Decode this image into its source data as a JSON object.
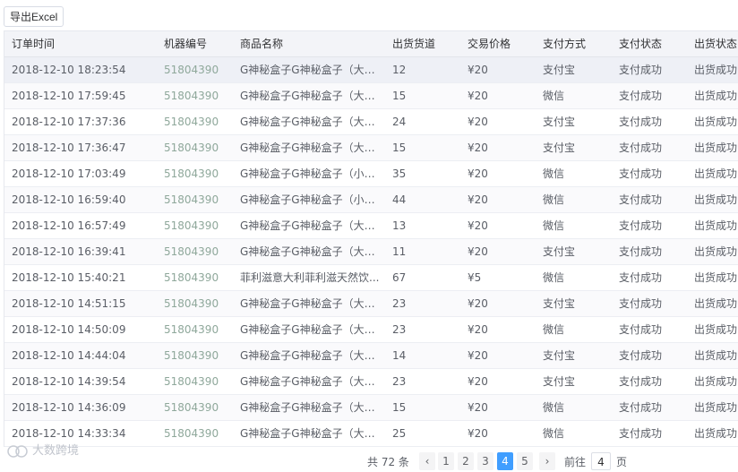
{
  "toolbar": {
    "export_label": "导出Excel"
  },
  "table": {
    "headers": [
      "订单时间",
      "机器编号",
      "商品名称",
      "出货货道",
      "交易价格",
      "支付方式",
      "支付状态",
      "出货状态"
    ],
    "rows": [
      [
        "2018-12-10 18:23:54",
        "51804390",
        "G神秘盒子G神秘盒子（大）...",
        "12",
        "¥20",
        "支付宝",
        "支付成功",
        "出货成功"
      ],
      [
        "2018-12-10 17:59:45",
        "51804390",
        "G神秘盒子G神秘盒子（大）...",
        "15",
        "¥20",
        "微信",
        "支付成功",
        "出货成功"
      ],
      [
        "2018-12-10 17:37:36",
        "51804390",
        "G神秘盒子G神秘盒子（大）...",
        "24",
        "¥20",
        "支付宝",
        "支付成功",
        "出货成功"
      ],
      [
        "2018-12-10 17:36:47",
        "51804390",
        "G神秘盒子G神秘盒子（大）...",
        "15",
        "¥20",
        "支付宝",
        "支付成功",
        "出货成功"
      ],
      [
        "2018-12-10 17:03:49",
        "51804390",
        "G神秘盒子G神秘盒子（小）...",
        "35",
        "¥20",
        "微信",
        "支付成功",
        "出货成功"
      ],
      [
        "2018-12-10 16:59:40",
        "51804390",
        "G神秘盒子G神秘盒子（小）...",
        "44",
        "¥20",
        "微信",
        "支付成功",
        "出货成功"
      ],
      [
        "2018-12-10 16:57:49",
        "51804390",
        "G神秘盒子G神秘盒子（大）...",
        "13",
        "¥20",
        "微信",
        "支付成功",
        "出货成功"
      ],
      [
        "2018-12-10 16:39:41",
        "51804390",
        "G神秘盒子G神秘盒子（大）...",
        "11",
        "¥20",
        "支付宝",
        "支付成功",
        "出货成功"
      ],
      [
        "2018-12-10 15:40:21",
        "51804390",
        "菲利滋意大利菲利滋天然饮...",
        "67",
        "¥5",
        "微信",
        "支付成功",
        "出货成功"
      ],
      [
        "2018-12-10 14:51:15",
        "51804390",
        "G神秘盒子G神秘盒子（大）...",
        "23",
        "¥20",
        "支付宝",
        "支付成功",
        "出货成功"
      ],
      [
        "2018-12-10 14:50:09",
        "51804390",
        "G神秘盒子G神秘盒子（大）...",
        "23",
        "¥20",
        "微信",
        "支付成功",
        "出货成功"
      ],
      [
        "2018-12-10 14:44:04",
        "51804390",
        "G神秘盒子G神秘盒子（大）...",
        "14",
        "¥20",
        "支付宝",
        "支付成功",
        "出货成功"
      ],
      [
        "2018-12-10 14:39:54",
        "51804390",
        "G神秘盒子G神秘盒子（大）...",
        "23",
        "¥20",
        "支付宝",
        "支付成功",
        "出货成功"
      ],
      [
        "2018-12-10 14:36:09",
        "51804390",
        "G神秘盒子G神秘盒子（大）...",
        "15",
        "¥20",
        "微信",
        "支付成功",
        "出货成功"
      ],
      [
        "2018-12-10 14:33:34",
        "51804390",
        "G神秘盒子G神秘盒子（大）...",
        "25",
        "¥20",
        "微信",
        "支付成功",
        "出货成功"
      ]
    ]
  },
  "pagination": {
    "total_text": "共 72 条",
    "prev_icon": "‹",
    "pages": [
      "1",
      "2",
      "3",
      "4",
      "5"
    ],
    "active_page": "4",
    "next_icon": "›",
    "goto_label": "前往",
    "goto_value": "4",
    "page_unit": "页"
  },
  "watermark": {
    "text": "大数跨境"
  },
  "icons": {
    "prev": "chevron-left-icon",
    "next": "chevron-right-icon",
    "logo": "watermark-logo-icon"
  },
  "colors": {
    "accent": "#409eff",
    "machine_id": "#8fa89b",
    "header_bg": "#f3f4f8"
  }
}
